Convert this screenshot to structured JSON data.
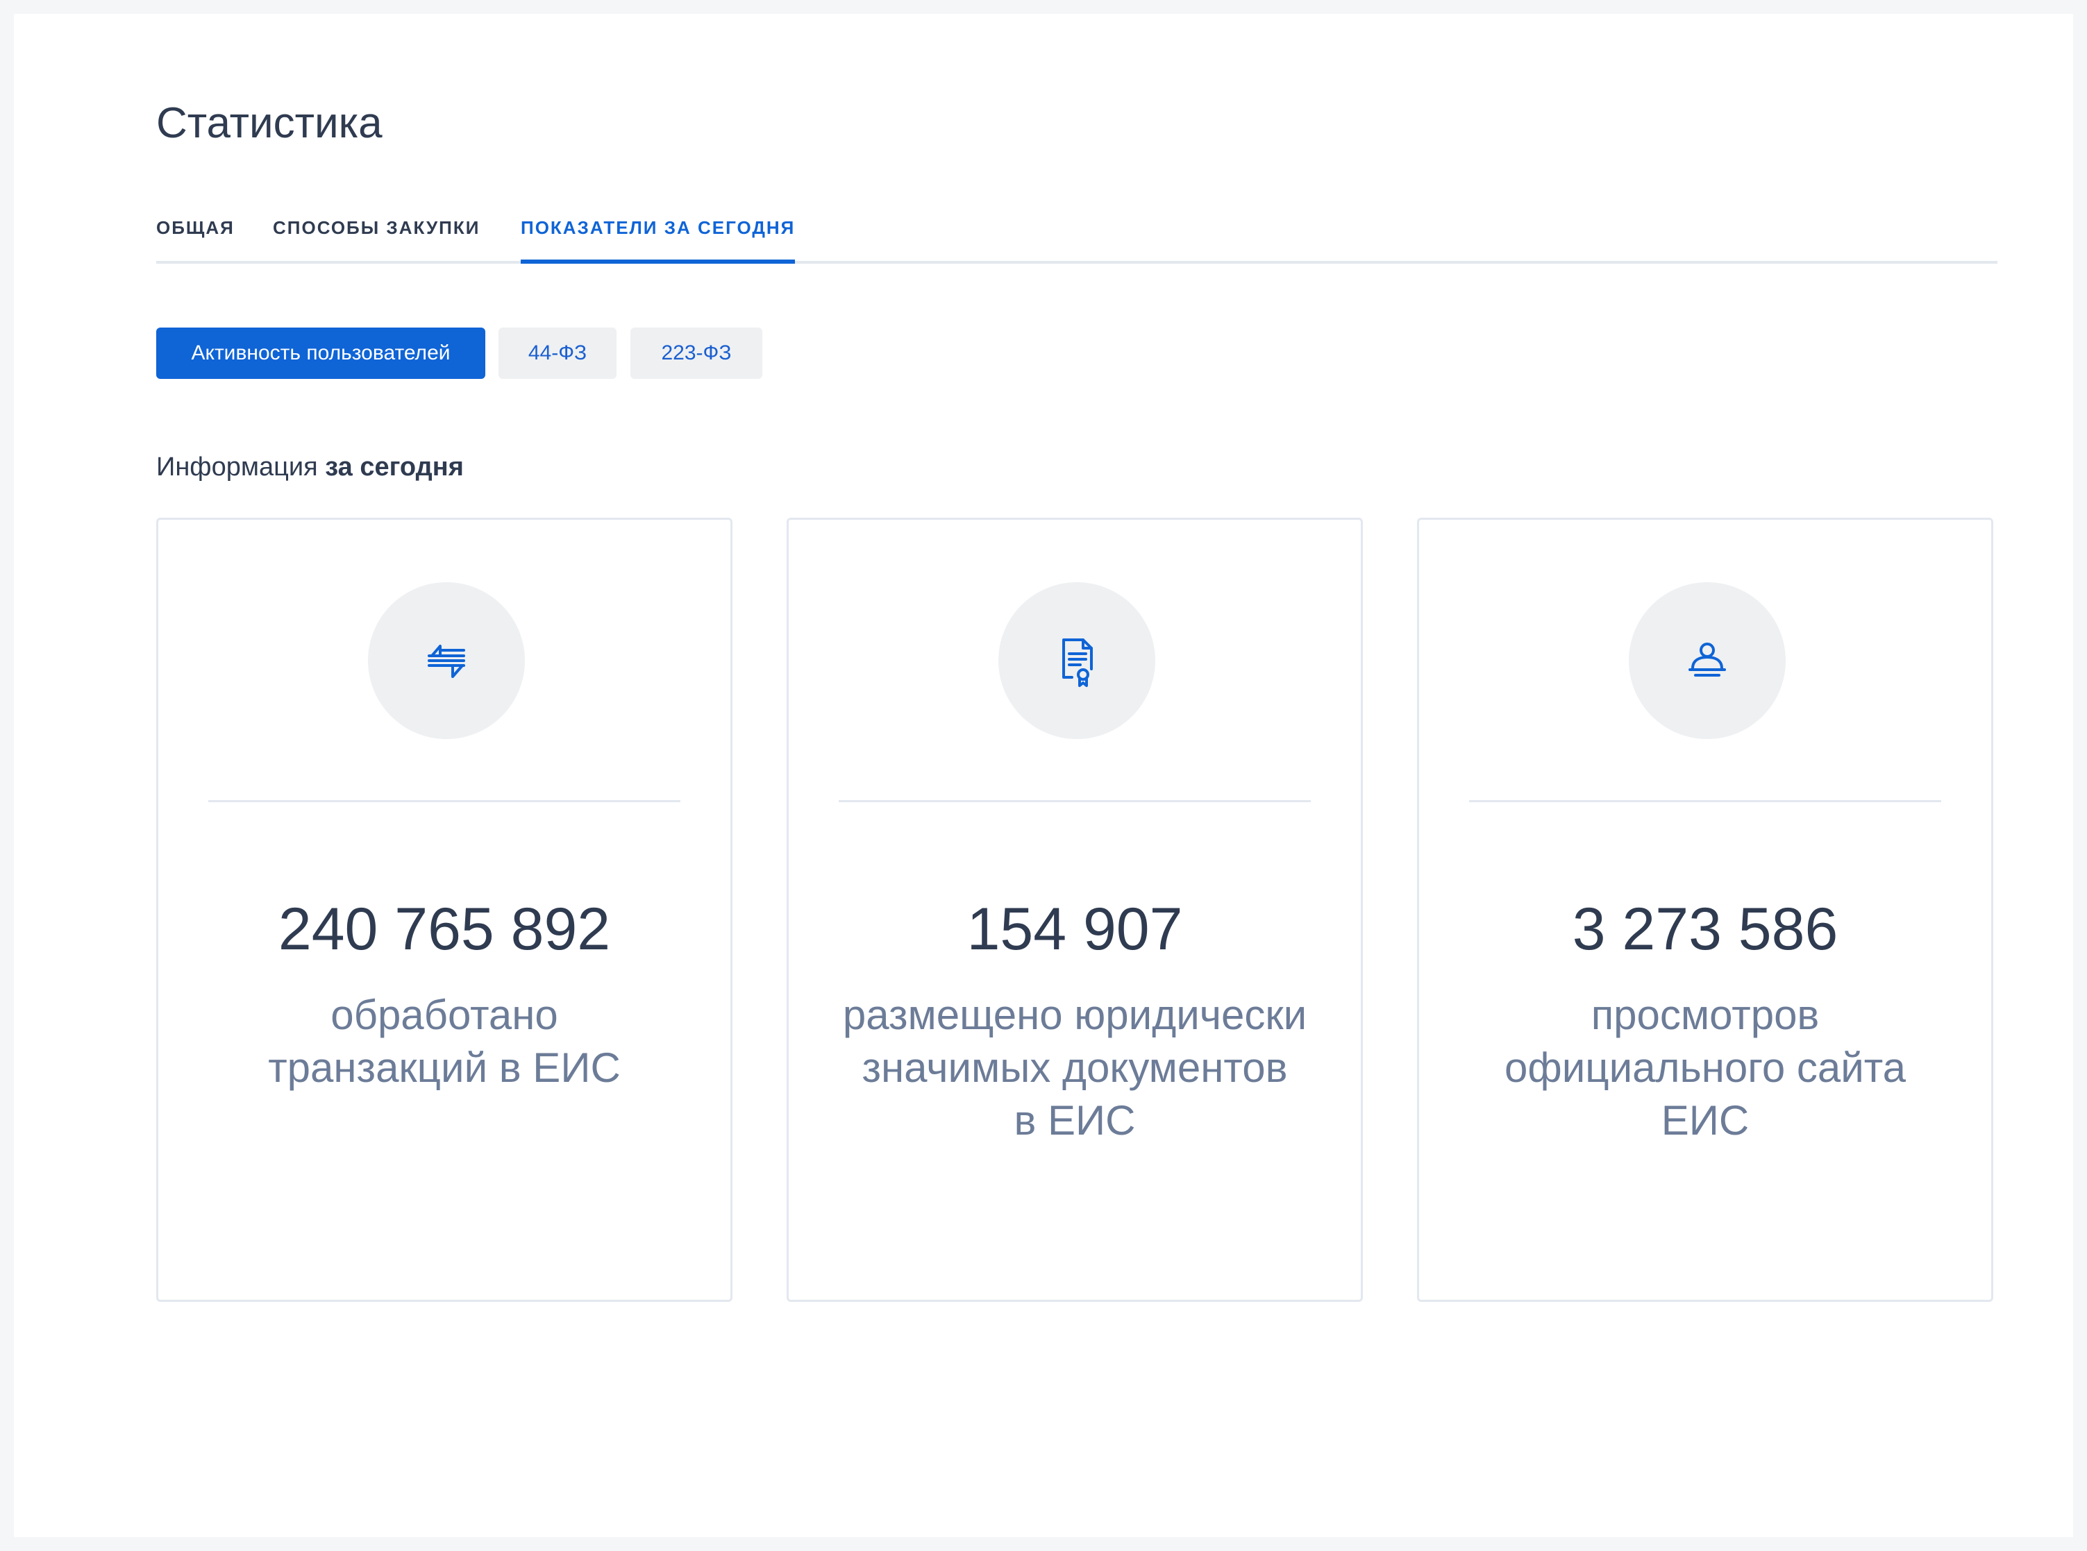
{
  "header": {
    "title": "Статистика"
  },
  "tabs": [
    {
      "label": "ОБЩАЯ",
      "active": false
    },
    {
      "label": "СПОСОБЫ ЗАКУПКИ",
      "active": false
    },
    {
      "label": "ПОКАЗАТЕЛИ ЗА СЕГОДНЯ",
      "active": true
    }
  ],
  "filters": {
    "active": "Активность пользователей",
    "law_44": "44-ФЗ",
    "law_223": "223-ФЗ"
  },
  "info": {
    "prefix": "Информация",
    "emphasis": "за сегодня"
  },
  "cards": [
    {
      "icon": "transactions-icon",
      "value": "240 765 892",
      "caption_lines": [
        "обработано",
        "транзакций в ЕИС"
      ]
    },
    {
      "icon": "certified-document-icon",
      "value": "154 907",
      "caption_lines": [
        "размещено юридически",
        "значимых документов",
        "в ЕИС"
      ]
    },
    {
      "icon": "user-visitor-icon",
      "value": "3 273 586",
      "caption_lines": [
        "просмотров",
        "официального сайта",
        "ЕИС"
      ]
    }
  ],
  "colors": {
    "accent": "#0f64d6",
    "text_dark": "#2f3b50",
    "text_muted": "#6c7c98",
    "border": "#e3e8ef",
    "chip_bg": "#eef0f2"
  }
}
